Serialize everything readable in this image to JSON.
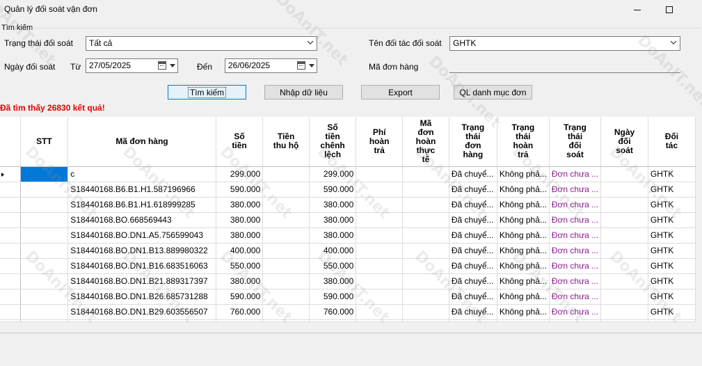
{
  "window": {
    "title": "Quản lý đối soát vận đơn"
  },
  "search": {
    "group_label": "Tìm kiếm",
    "status_label": "Trạng thái đối soát",
    "status_value": "Tất cả",
    "partner_label": "Tên đối tác đối soát",
    "partner_value": "GHTK",
    "date_label": "Ngày đối soát",
    "from_label": "Từ",
    "from_value": "27/05/2025",
    "to_label": "Đến",
    "to_value": "26/06/2025",
    "order_label": "Mã đơn hàng",
    "order_value": ""
  },
  "toolbar": {
    "search_label": "Tìm kiếm",
    "import_label": "Nhập dữ liệu",
    "export_label": "Export",
    "category_label": "QL danh mục đơn"
  },
  "result": {
    "message": "Đã tìm thấy 26830 kết quả!"
  },
  "grid": {
    "columns": [
      "STT",
      "Mã đơn hàng",
      "Số\ntiền",
      "Tiền\nthu hộ",
      "Số\ntiền\nchênh\nlệch",
      "Phí\nhoàn\ntrả",
      "Mã\nđơn\nhoàn\nthực\ntế",
      "Trạng\nthái\nđơn\nhàng",
      "Trạng\nthái\nhoàn\ntrả",
      "Trạng\nthái\nđối\nsoát",
      "Ngày\nđối\nsoát",
      "Đối\ntác"
    ],
    "rows": [
      {
        "stt": "",
        "code": "c",
        "amount": "299.000",
        "cod": "",
        "diff": "299.000",
        "fee": "",
        "return_code": "",
        "order_status": "Đã chuyể...",
        "return_status": "Không phả...",
        "recon_status": "Đơn chưa ...",
        "recon_date": "",
        "partner": "GHTK"
      },
      {
        "stt": "",
        "code": "S18440168.B6.B1.H1.587196966",
        "amount": "590.000",
        "cod": "",
        "diff": "590.000",
        "fee": "",
        "return_code": "",
        "order_status": "Đã chuyể...",
        "return_status": "Không phả...",
        "recon_status": "Đơn chưa ...",
        "recon_date": "",
        "partner": "GHTK"
      },
      {
        "stt": "",
        "code": "S18440168.B6.B1.H1.618999285",
        "amount": "380.000",
        "cod": "",
        "diff": "380.000",
        "fee": "",
        "return_code": "",
        "order_status": "Đã chuyể...",
        "return_status": "Không phả...",
        "recon_status": "Đơn chưa ...",
        "recon_date": "",
        "partner": "GHTK"
      },
      {
        "stt": "",
        "code": "S18440168.BO.668569443",
        "amount": "380.000",
        "cod": "",
        "diff": "380.000",
        "fee": "",
        "return_code": "",
        "order_status": "Đã chuyể...",
        "return_status": "Không phả...",
        "recon_status": "Đơn chưa ...",
        "recon_date": "",
        "partner": "GHTK"
      },
      {
        "stt": "",
        "code": "S18440168.BO.DN1.A5.756599043",
        "amount": "380.000",
        "cod": "",
        "diff": "380.000",
        "fee": "",
        "return_code": "",
        "order_status": "Đã chuyể...",
        "return_status": "Không phả...",
        "recon_status": "Đơn chưa ...",
        "recon_date": "",
        "partner": "GHTK"
      },
      {
        "stt": "",
        "code": "S18440168.BO.DN1.B13.889980322",
        "amount": "400.000",
        "cod": "",
        "diff": "400.000",
        "fee": "",
        "return_code": "",
        "order_status": "Đã chuyể...",
        "return_status": "Không phả...",
        "recon_status": "Đơn chưa ...",
        "recon_date": "",
        "partner": "GHTK"
      },
      {
        "stt": "",
        "code": "S18440168.BO.DN1.B16.683516063",
        "amount": "550.000",
        "cod": "",
        "diff": "550.000",
        "fee": "",
        "return_code": "",
        "order_status": "Đã chuyể...",
        "return_status": "Không phả...",
        "recon_status": "Đơn chưa ...",
        "recon_date": "",
        "partner": "GHTK"
      },
      {
        "stt": "",
        "code": "S18440168.BO.DN1.B21.889317397",
        "amount": "380.000",
        "cod": "",
        "diff": "380.000",
        "fee": "",
        "return_code": "",
        "order_status": "Đã chuyể...",
        "return_status": "Không phả...",
        "recon_status": "Đơn chưa ...",
        "recon_date": "",
        "partner": "GHTK"
      },
      {
        "stt": "",
        "code": "S18440168.BO.DN1.B26.685731288",
        "amount": "590.000",
        "cod": "",
        "diff": "590.000",
        "fee": "",
        "return_code": "",
        "order_status": "Đã chuyể...",
        "return_status": "Không phả...",
        "recon_status": "Đơn chưa ...",
        "recon_date": "",
        "partner": "GHTK"
      },
      {
        "stt": "",
        "code": "S18440168.BO.DN1.B29.603556507",
        "amount": "760.000",
        "cod": "",
        "diff": "760.000",
        "fee": "",
        "return_code": "",
        "order_status": "Đã chuyể...",
        "return_status": "Không phả...",
        "recon_status": "Đơn chưa ...",
        "recon_date": "",
        "partner": "GHTK"
      }
    ]
  },
  "watermark": "DoAnIT.net"
}
